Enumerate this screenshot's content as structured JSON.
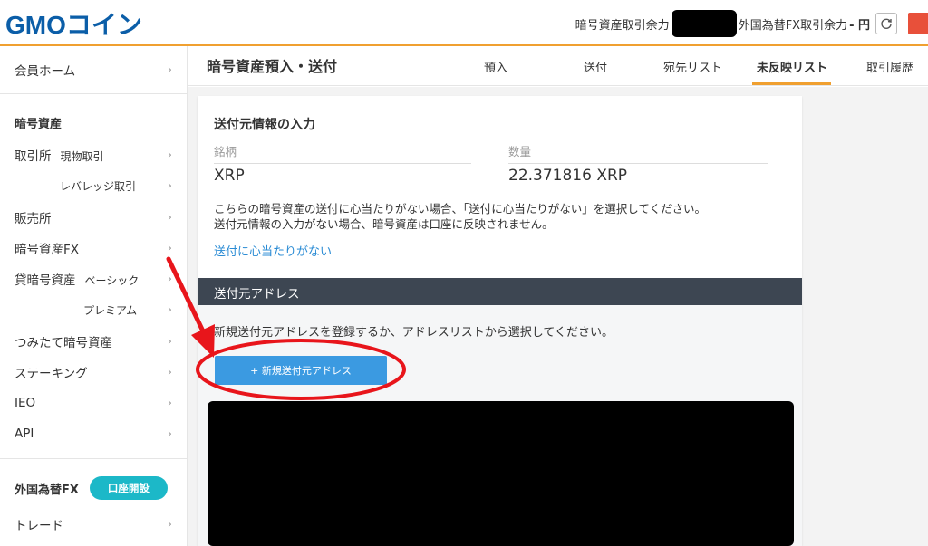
{
  "header": {
    "logo_text": "GMOコイン",
    "balance_label": "暗号資産取引余力",
    "fx_label": "外国為替FX取引余力",
    "fx_unit": "- 円",
    "refresh_icon": "refresh-icon"
  },
  "sidebar": {
    "home": "会員ホーム",
    "crypto_head": "暗号資産",
    "exchange": "取引所",
    "spot": "現物取引",
    "leverage": "レバレッジ取引",
    "sales": "販売所",
    "crypto_fx": "暗号資産FX",
    "lending": "貸暗号資産",
    "basic": "ベーシック",
    "premium": "プレミアム",
    "tsumitate": "つみたて暗号資産",
    "staking": "ステーキング",
    "ieo": "IEO",
    "api": "API",
    "fx_head": "外国為替FX",
    "open_account": "口座開設",
    "trade": "トレード",
    "chevron": "›"
  },
  "page": {
    "title": "暗号資産預入・送付"
  },
  "tabs": {
    "deposit": "預入",
    "send": "送付",
    "dest_list": "宛先リスト",
    "unreflected": "未反映リスト",
    "history": "取引履歴"
  },
  "card": {
    "title": "送付元情報の入力",
    "symbol_label": "銘柄",
    "symbol_value": "XRP",
    "qty_label": "数量",
    "qty_value": "22.371816 XRP",
    "note1": "こちらの暗号資産の送付に心当たりがない場合、「送付に心当たりがない」を選択してください。",
    "note2": "送付元情報の入力がない場合、暗号資産は口座に反映されません。",
    "link": "送付に心当たりがない",
    "section": "送付元アドレス",
    "instruction": "新規送付元アドレスを登録するか、アドレスリストから選択してください。",
    "add_button": "+ 新規送付元アドレス"
  },
  "colors": {
    "accent": "#f0a030",
    "button": "#3b9ae1",
    "section_bar": "#3d4652",
    "link": "#2a8bd4",
    "annotation": "#e8151b",
    "teal": "#1cb8c8"
  }
}
